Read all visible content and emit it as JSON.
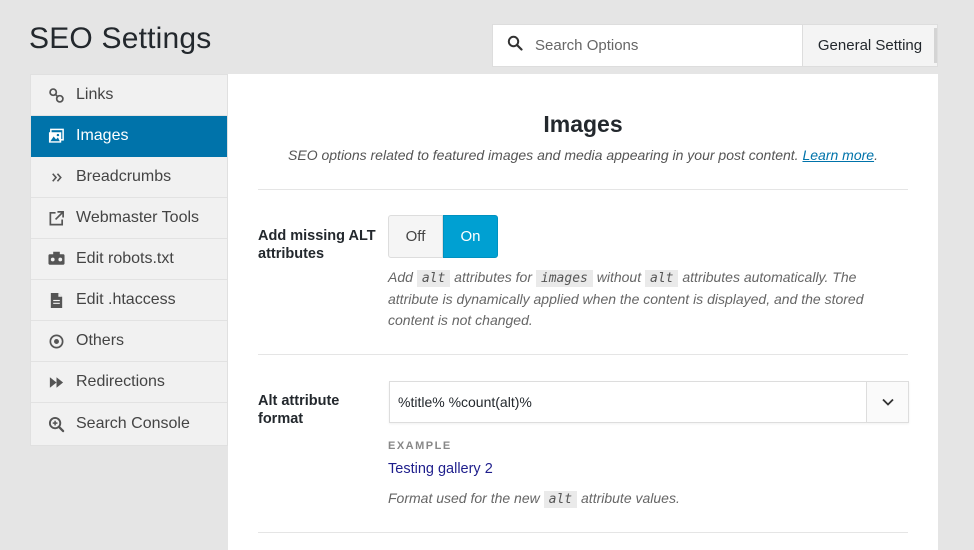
{
  "page_title": "SEO Settings",
  "topbar": {
    "search_placeholder": "Search Options",
    "general_button": "General Setting"
  },
  "sidebar": {
    "items": [
      {
        "label": "Links",
        "icon": "link-icon",
        "active": false
      },
      {
        "label": "Images",
        "icon": "image-icon",
        "active": true
      },
      {
        "label": "Breadcrumbs",
        "icon": "double-chevron-icon",
        "active": false
      },
      {
        "label": "Webmaster Tools",
        "icon": "external-link-icon",
        "active": false
      },
      {
        "label": "Edit robots.txt",
        "icon": "robot-icon",
        "active": false
      },
      {
        "label": "Edit .htaccess",
        "icon": "file-icon",
        "active": false
      },
      {
        "label": "Others",
        "icon": "circle-dot-icon",
        "active": false
      },
      {
        "label": "Redirections",
        "icon": "fast-forward-icon",
        "active": false
      },
      {
        "label": "Search Console",
        "icon": "zoom-icon",
        "active": false
      }
    ]
  },
  "main": {
    "title": "Images",
    "subtitle": "SEO options related to featured images and media appearing in your post content.",
    "learn_more": "Learn more",
    "learn_more_suffix": ".",
    "alt_field": {
      "label_line1": "Add missing ALT",
      "label_line2": "attributes",
      "toggle_off": "Off",
      "toggle_on": "On",
      "selected": "On",
      "desc_1": "Add ",
      "code_1": "alt",
      "desc_2": " attributes for ",
      "code_2": "images",
      "desc_3": " without ",
      "code_3": "alt",
      "desc_4": " attributes automatically. The",
      "desc_line2": "attribute is dynamically applied when the content is displayed, and the stored",
      "desc_line3": "content is not changed."
    },
    "format_field": {
      "label_line1": "Alt attribute",
      "label_line2": "format",
      "value": "%title% %count(alt)%",
      "example_label": "EXAMPLE",
      "example_value": "Testing gallery 2",
      "desc_1": "Format used for the new ",
      "code": "alt",
      "desc_2": " attribute values."
    }
  },
  "colors": {
    "accent": "#0073aa",
    "toggle_on": "#00a0d2",
    "background": "#e5e5e5"
  }
}
